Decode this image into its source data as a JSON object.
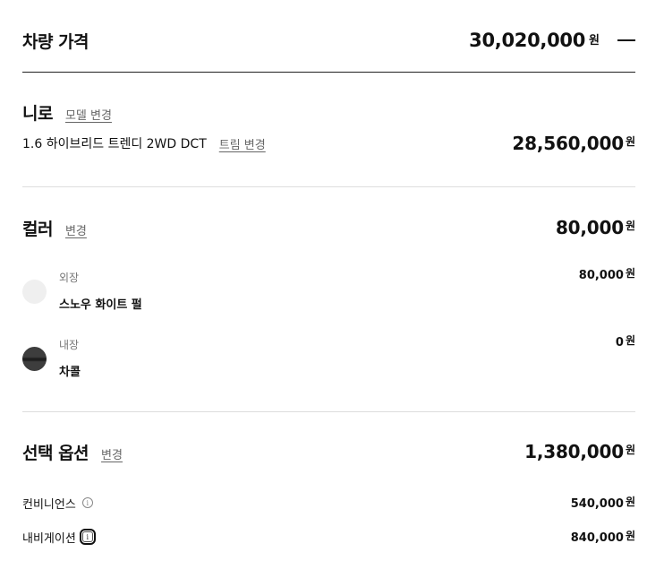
{
  "header": {
    "title": "차량 가격",
    "total": "30,020,000",
    "currency": "원",
    "collapse_icon": "minus-icon"
  },
  "model": {
    "name": "니로",
    "change_label": "모델 변경",
    "trim": "1.6 하이브리드 트렌디 2WD DCT",
    "trim_change_label": "트림 변경",
    "price": "28,560,000",
    "currency": "원"
  },
  "color": {
    "title": "컬러",
    "change_label": "변경",
    "total": "80,000",
    "currency": "원",
    "items": [
      {
        "category": "외장",
        "name": "스노우 화이트 펄",
        "price": "80,000",
        "currency": "원",
        "swatch_color": "#efefef"
      },
      {
        "category": "내장",
        "name": "차콜",
        "price": "0",
        "currency": "원",
        "swatch_color": "#3d3d3d"
      }
    ]
  },
  "options": {
    "title": "선택 옵션",
    "change_label": "변경",
    "total": "1,380,000",
    "currency": "원",
    "items": [
      {
        "name": "컨비니언스",
        "price": "540,000",
        "currency": "원",
        "info_icon": "info-icon"
      },
      {
        "name": "내비게이션",
        "price": "840,000",
        "currency": "원",
        "info_icon": "info-icon"
      }
    ]
  }
}
